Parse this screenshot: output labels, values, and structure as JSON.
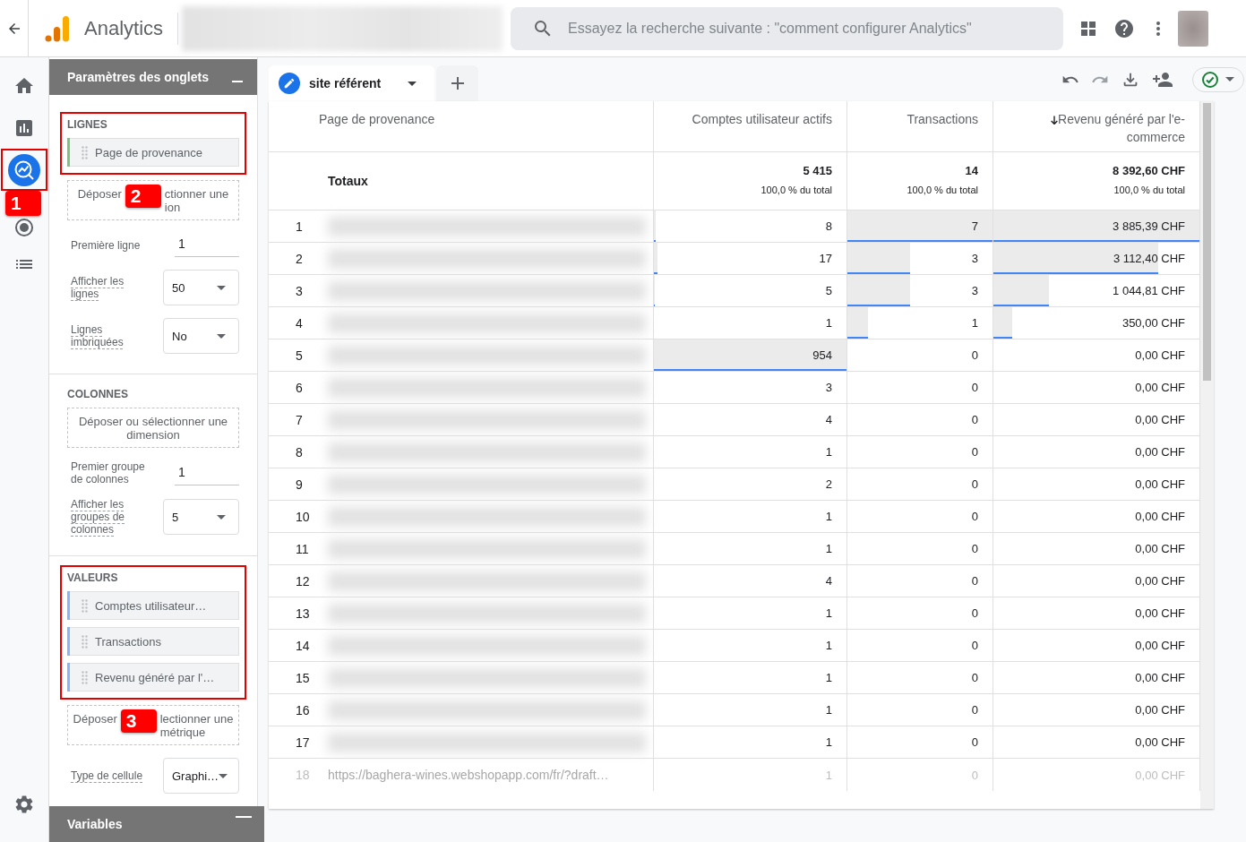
{
  "app": {
    "title": "Analytics"
  },
  "search": {
    "placeholder": "Essayez la recherche suivante : \"comment configurer Analytics\""
  },
  "nav_items": [
    {
      "selected": false
    },
    {
      "selected": false
    },
    {
      "selected": true,
      "annotation": "1"
    },
    {
      "selected": false
    },
    {
      "selected": false
    }
  ],
  "tab_settings": {
    "title": "Paramètres des onglets",
    "rows_section": {
      "heading": "LIGNES",
      "annotation": "2",
      "chips": [
        {
          "label": "Page de provenance",
          "color": "#7cc47f"
        }
      ],
      "drop_hint_visible": [
        "Déposer",
        "ctionner une",
        "ion"
      ],
      "fields": [
        {
          "kind": "input",
          "label": "Première ligne",
          "value": "1"
        },
        {
          "kind": "select",
          "label": "Afficher les lignes",
          "value": "50"
        },
        {
          "kind": "select",
          "label": "Lignes imbriquées",
          "value": "No"
        }
      ]
    },
    "columns_section": {
      "heading": "COLONNES",
      "drop_hint": "Déposer ou sélectionner une dimension",
      "fields": [
        {
          "kind": "input",
          "label": "Premier groupe de colonnes",
          "value": "1"
        },
        {
          "kind": "select",
          "label": "Afficher les groupes de colonnes",
          "value": "5"
        }
      ]
    },
    "values_section": {
      "heading": "VALEURS",
      "annotation": "3",
      "chips": [
        {
          "label": "Comptes utilisateur…",
          "color": "#8ab4f8"
        },
        {
          "label": "Transactions",
          "color": "#8ab4f8"
        },
        {
          "label": "Revenu généré par l'…",
          "color": "#8ab4f8"
        }
      ],
      "drop_hint_visible": [
        "Déposer",
        "lectionner une",
        "métrique"
      ],
      "fields": [
        {
          "kind": "select",
          "label": "Type de cellule",
          "value": "Graphi…"
        }
      ]
    }
  },
  "variables": {
    "title": "Variables"
  },
  "tabs": [
    {
      "label": "site référent",
      "selected": true
    }
  ],
  "table": {
    "columns": [
      {
        "label": "Page de provenance",
        "sorted": false
      },
      {
        "label": "Comptes utilisateur actifs",
        "sorted": false
      },
      {
        "label": "Transactions",
        "sorted": false
      },
      {
        "label": "Revenu généré par l'e-commerce",
        "sorted": true
      }
    ],
    "totals": {
      "label": "Totaux",
      "values": [
        {
          "value": "5 415",
          "share": "100,0 % du total"
        },
        {
          "value": "14",
          "share": "100,0 % du total"
        },
        {
          "value": "8 392,60 CHF",
          "share": "100,0 % du total"
        }
      ]
    },
    "rows": [
      {
        "index": "1",
        "faded": false,
        "cells": [
          {
            "kind": "redacted"
          },
          {
            "kind": "metric",
            "value": "8",
            "level": 0.008
          },
          {
            "kind": "metric",
            "value": "7",
            "level": 1
          },
          {
            "kind": "metric",
            "value": "3 885,39 CHF",
            "level": 1
          }
        ]
      },
      {
        "index": "2",
        "faded": false,
        "cells": [
          {
            "kind": "redacted"
          },
          {
            "kind": "metric",
            "value": "17",
            "level": 0.018
          },
          {
            "kind": "metric",
            "value": "3",
            "level": 0.43
          },
          {
            "kind": "metric",
            "value": "3 112,40 CHF",
            "level": 0.8
          }
        ]
      },
      {
        "index": "3",
        "faded": false,
        "cells": [
          {
            "kind": "redacted"
          },
          {
            "kind": "metric",
            "value": "5",
            "level": 0.005
          },
          {
            "kind": "metric",
            "value": "3",
            "level": 0.43
          },
          {
            "kind": "metric",
            "value": "1 044,81 CHF",
            "level": 0.27
          }
        ]
      },
      {
        "index": "4",
        "faded": false,
        "cells": [
          {
            "kind": "redacted"
          },
          {
            "kind": "metric",
            "value": "1"
          },
          {
            "kind": "metric",
            "value": "1",
            "level": 0.14
          },
          {
            "kind": "metric",
            "value": "350,00 CHF",
            "level": 0.09
          }
        ]
      },
      {
        "index": "5",
        "faded": false,
        "cells": [
          {
            "kind": "redacted"
          },
          {
            "kind": "metric",
            "value": "954",
            "level": 1
          },
          {
            "kind": "metric",
            "value": "0"
          },
          {
            "kind": "metric",
            "value": "0,00 CHF"
          }
        ]
      },
      {
        "index": "6",
        "faded": false,
        "cells": [
          {
            "kind": "redacted"
          },
          {
            "kind": "metric",
            "value": "3"
          },
          {
            "kind": "metric",
            "value": "0"
          },
          {
            "kind": "metric",
            "value": "0,00 CHF"
          }
        ]
      },
      {
        "index": "7",
        "faded": false,
        "cells": [
          {
            "kind": "redacted"
          },
          {
            "kind": "metric",
            "value": "4"
          },
          {
            "kind": "metric",
            "value": "0"
          },
          {
            "kind": "metric",
            "value": "0,00 CHF"
          }
        ]
      },
      {
        "index": "8",
        "faded": false,
        "cells": [
          {
            "kind": "redacted"
          },
          {
            "kind": "metric",
            "value": "1"
          },
          {
            "kind": "metric",
            "value": "0"
          },
          {
            "kind": "metric",
            "value": "0,00 CHF"
          }
        ]
      },
      {
        "index": "9",
        "faded": false,
        "cells": [
          {
            "kind": "redacted"
          },
          {
            "kind": "metric",
            "value": "2"
          },
          {
            "kind": "metric",
            "value": "0"
          },
          {
            "kind": "metric",
            "value": "0,00 CHF"
          }
        ]
      },
      {
        "index": "10",
        "faded": false,
        "cells": [
          {
            "kind": "redacted"
          },
          {
            "kind": "metric",
            "value": "1"
          },
          {
            "kind": "metric",
            "value": "0"
          },
          {
            "kind": "metric",
            "value": "0,00 CHF"
          }
        ]
      },
      {
        "index": "11",
        "faded": false,
        "cells": [
          {
            "kind": "redacted"
          },
          {
            "kind": "metric",
            "value": "1"
          },
          {
            "kind": "metric",
            "value": "0"
          },
          {
            "kind": "metric",
            "value": "0,00 CHF"
          }
        ]
      },
      {
        "index": "12",
        "faded": false,
        "cells": [
          {
            "kind": "redacted"
          },
          {
            "kind": "metric",
            "value": "4"
          },
          {
            "kind": "metric",
            "value": "0"
          },
          {
            "kind": "metric",
            "value": "0,00 CHF"
          }
        ]
      },
      {
        "index": "13",
        "faded": false,
        "cells": [
          {
            "kind": "redacted"
          },
          {
            "kind": "metric",
            "value": "1"
          },
          {
            "kind": "metric",
            "value": "0"
          },
          {
            "kind": "metric",
            "value": "0,00 CHF"
          }
        ]
      },
      {
        "index": "14",
        "faded": false,
        "cells": [
          {
            "kind": "redacted"
          },
          {
            "kind": "metric",
            "value": "1"
          },
          {
            "kind": "metric",
            "value": "0"
          },
          {
            "kind": "metric",
            "value": "0,00 CHF"
          }
        ]
      },
      {
        "index": "15",
        "faded": false,
        "cells": [
          {
            "kind": "redacted"
          },
          {
            "kind": "metric",
            "value": "1"
          },
          {
            "kind": "metric",
            "value": "0"
          },
          {
            "kind": "metric",
            "value": "0,00 CHF"
          }
        ]
      },
      {
        "index": "16",
        "faded": false,
        "cells": [
          {
            "kind": "redacted"
          },
          {
            "kind": "metric",
            "value": "1"
          },
          {
            "kind": "metric",
            "value": "0"
          },
          {
            "kind": "metric",
            "value": "0,00 CHF"
          }
        ]
      },
      {
        "index": "17",
        "faded": false,
        "cells": [
          {
            "kind": "redacted"
          },
          {
            "kind": "metric",
            "value": "1"
          },
          {
            "kind": "metric",
            "value": "0"
          },
          {
            "kind": "metric",
            "value": "0,00 CHF"
          }
        ]
      },
      {
        "index": "18",
        "faded": true,
        "cells": [
          {
            "kind": "text",
            "value": "https://baghera-wines.webshopapp.com/fr/?draft…"
          },
          {
            "kind": "metric",
            "value": "1"
          },
          {
            "kind": "metric",
            "value": "0"
          },
          {
            "kind": "metric",
            "value": "0,00 CHF"
          }
        ]
      }
    ]
  }
}
